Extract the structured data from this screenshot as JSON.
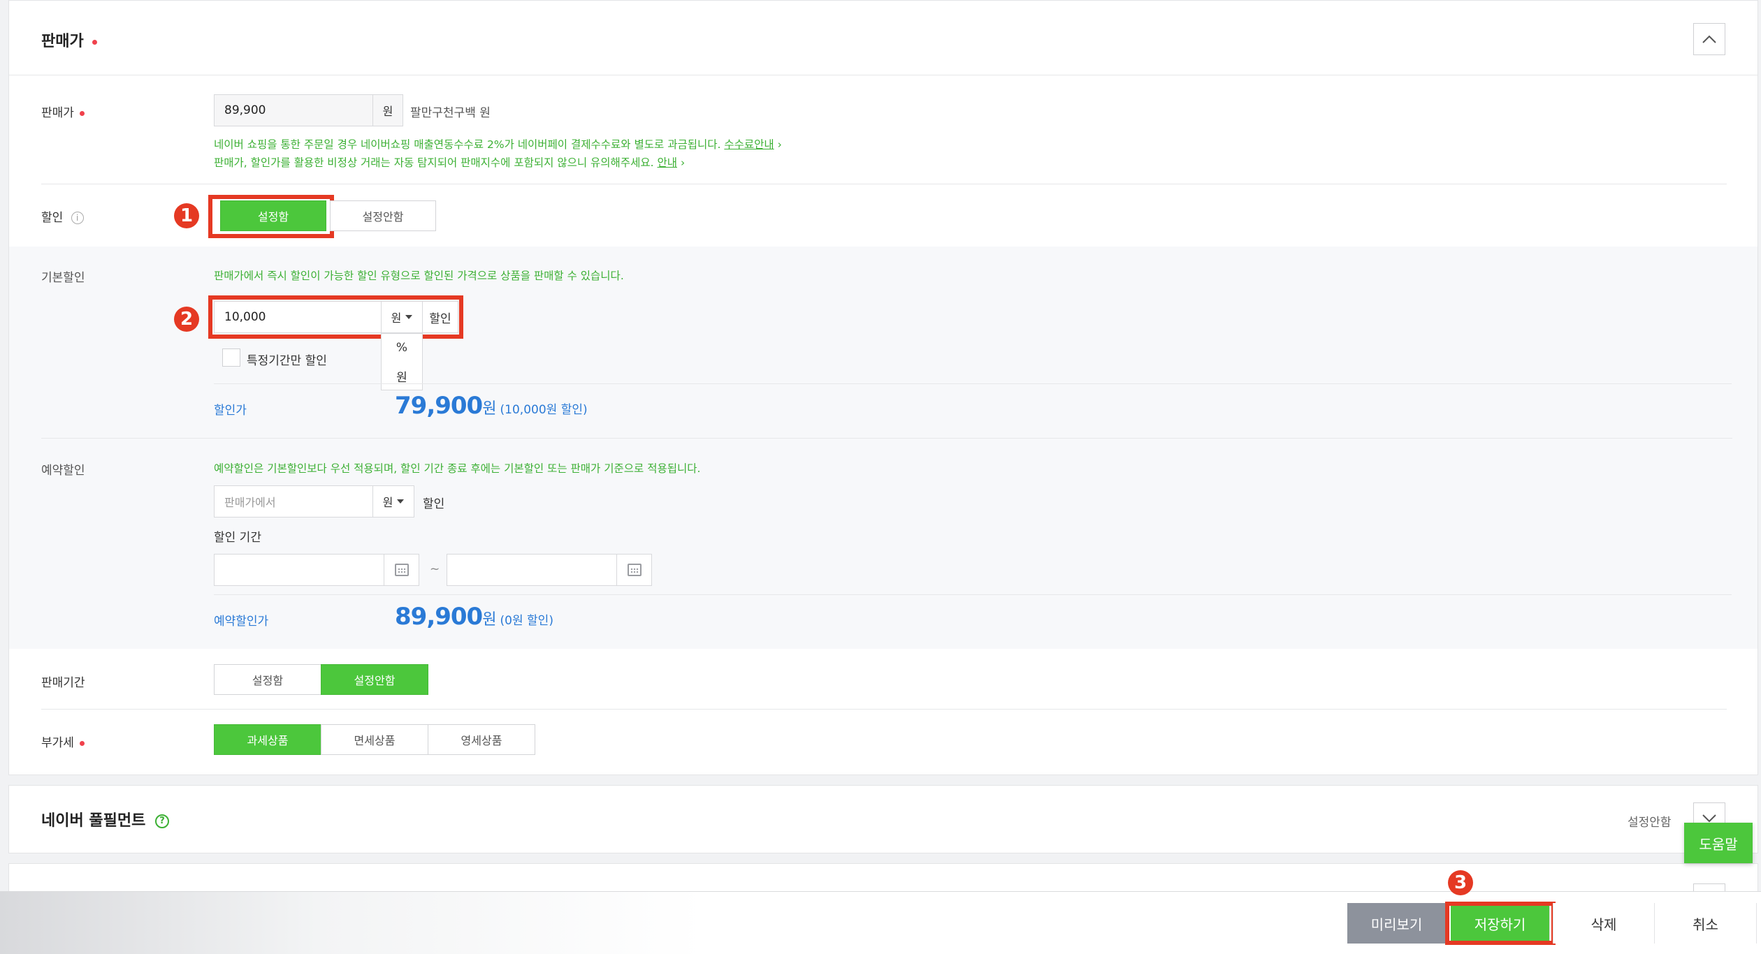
{
  "sale_section": {
    "title": "판매가",
    "price_label": "판매가",
    "price_value": "89,900",
    "price_unit": "원",
    "price_korean": "팔만구천구백 원",
    "notice1": "네이버 쇼핑을 통한 주문일 경우 네이버쇼핑 매출연동수수료 2%가 네이버페이 결제수수료와 별도로 과금됩니다.",
    "notice1_link": "수수료안내",
    "notice2": "판매가, 할인가를 활용한 비정상 거래는 자동 탐지되어 판매지수에 포함되지 않으니 유의해주세요.",
    "notice2_link": "안내",
    "link_arrow": "›"
  },
  "discount": {
    "label": "할인",
    "info_icon_glyph": "i",
    "on_label": "설정함",
    "off_label": "설정안함",
    "selected": "설정함"
  },
  "basic_discount": {
    "label": "기본할인",
    "notice": "판매가에서 즉시 할인이 가능한 할인 유형으로 할인된 가격으로 상품을 판매할 수 있습니다.",
    "amount_value": "10,000",
    "unit_selected": "원",
    "suffix": "할인",
    "dropdown_options": [
      "%",
      "원"
    ],
    "period_checkbox_label": "특정기간만 할인",
    "result_label": "할인가",
    "result_price": "79,900",
    "result_won": "원",
    "result_sub": "(10,000원 할인)"
  },
  "reserve_discount": {
    "label": "예약할인",
    "notice": "예약할인은 기본할인보다 우선 적용되며, 할인 기간 종료 후에는 기본할인 또는 판매가 기준으로 적용됩니다.",
    "amount_placeholder": "판매가에서",
    "unit_selected": "원",
    "suffix": "할인",
    "period_label": "할인 기간",
    "tilde": "~",
    "result_label": "예약할인가",
    "result_price": "89,900",
    "result_won": "원",
    "result_sub": "(0원 할인)"
  },
  "sale_period": {
    "label": "판매기간",
    "on_label": "설정함",
    "off_label": "설정안함",
    "selected": "설정안함"
  },
  "vat": {
    "label": "부가세",
    "options": [
      "과세상품",
      "면세상품",
      "영세상품"
    ],
    "selected": "과세상품"
  },
  "fulfillment": {
    "title": "네이버 풀필먼트",
    "status": "설정안함",
    "help_glyph": "?"
  },
  "help_button": "도움말",
  "annotations": [
    "1",
    "2",
    "3"
  ],
  "bottom_bar": {
    "preview": "미리보기",
    "save": "저장하기",
    "delete": "삭제",
    "cancel": "취소"
  },
  "colors": {
    "green": "#4cc73c",
    "green_text": "#3cb034",
    "blue_price": "#2a7ad6",
    "annotation_red": "#e53923",
    "required_dot": "#f0414c",
    "preview_bg": "#8d929c"
  }
}
